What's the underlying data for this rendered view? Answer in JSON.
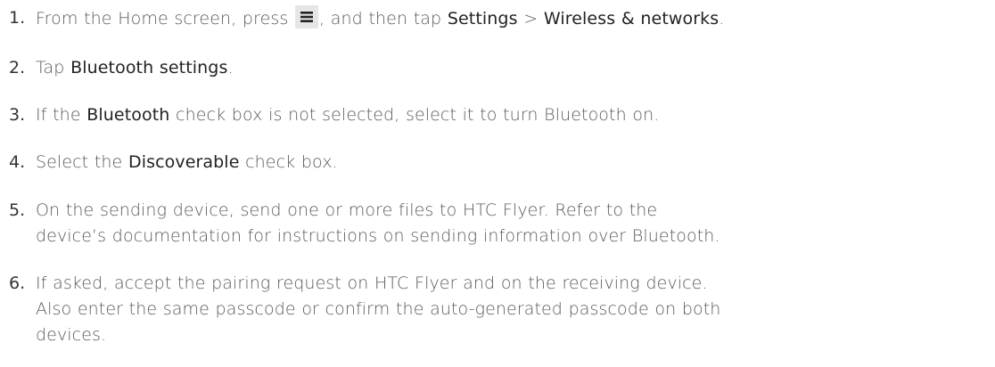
{
  "steps": [
    {
      "number": "1.",
      "parts": {
        "p1": "From the Home screen, press ",
        "icon": "menu-icon",
        "p2": ", and then tap ",
        "e1": "Settings",
        "p3": " > ",
        "e2": "Wireless & networks",
        "p4": "."
      }
    },
    {
      "number": "2.",
      "parts": {
        "p1": "Tap ",
        "e1": "Bluetooth settings",
        "p2": "."
      }
    },
    {
      "number": "3.",
      "parts": {
        "p1": "If the ",
        "e1": "Bluetooth",
        "p2": " check box is not selected, select it to turn Bluetooth on."
      }
    },
    {
      "number": "4.",
      "parts": {
        "p1": "Select the ",
        "e1": "Discoverable",
        "p2": " check box."
      }
    },
    {
      "number": "5.",
      "parts": {
        "line1": "On the sending device, send one or more files to HTC Flyer. Refer to the",
        "line2": "device’s documentation for instructions on sending information over Bluetooth."
      }
    },
    {
      "number": "6.",
      "parts": {
        "line1": "If asked, accept the pairing request on HTC Flyer and on the receiving device.",
        "line2": "Also enter the same passcode or confirm the auto-generated passcode on both",
        "line3": "devices."
      }
    }
  ]
}
